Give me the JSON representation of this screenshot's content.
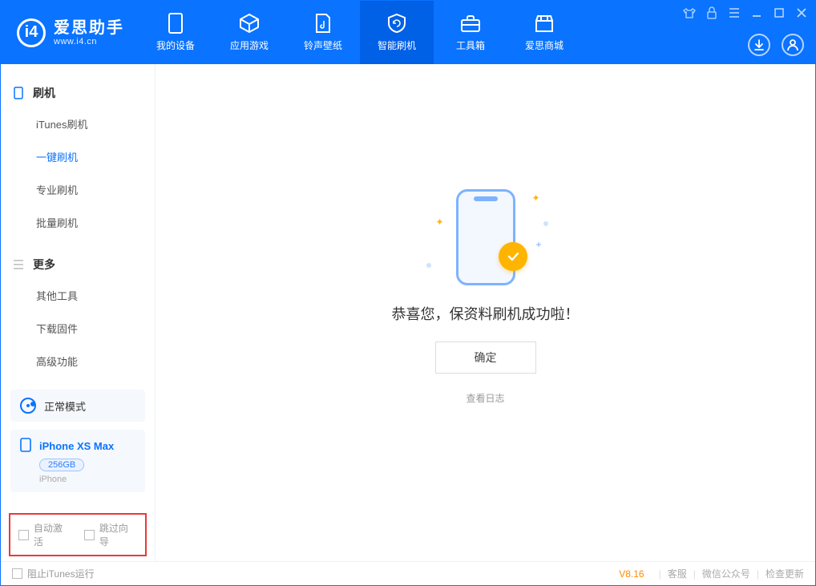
{
  "app": {
    "name_cn": "爱思助手",
    "name_en": "www.i4.cn"
  },
  "nav": {
    "items": [
      {
        "label": "我的设备"
      },
      {
        "label": "应用游戏"
      },
      {
        "label": "铃声壁纸"
      },
      {
        "label": "智能刷机"
      },
      {
        "label": "工具箱"
      },
      {
        "label": "爱思商城"
      }
    ],
    "active_index": 3
  },
  "sidebar": {
    "group1_title": "刷机",
    "group1_items": [
      "iTunes刷机",
      "一键刷机",
      "专业刷机",
      "批量刷机"
    ],
    "group1_active_index": 1,
    "group2_title": "更多",
    "group2_items": [
      "其他工具",
      "下载固件",
      "高级功能"
    ]
  },
  "mode": {
    "label": "正常模式"
  },
  "device": {
    "name": "iPhone XS Max",
    "storage": "256GB",
    "type": "iPhone"
  },
  "bottom_checks": {
    "auto_activate": "自动激活",
    "skip_guide": "跳过向导"
  },
  "main": {
    "success_text": "恭喜您，保资料刷机成功啦！",
    "ok_button": "确定",
    "view_log": "查看日志"
  },
  "statusbar": {
    "block_itunes": "阻止iTunes运行",
    "version": "V8.16",
    "links": [
      "客服",
      "微信公众号",
      "检查更新"
    ]
  }
}
